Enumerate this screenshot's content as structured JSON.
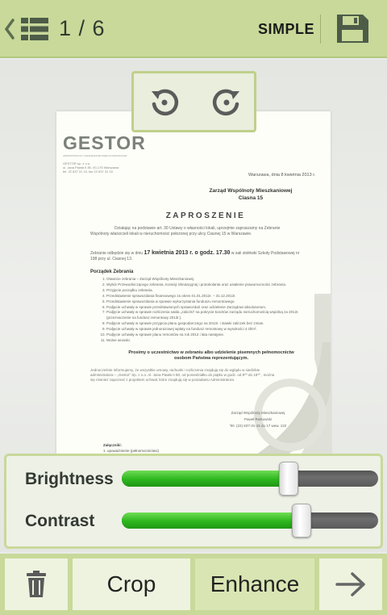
{
  "header": {
    "page_counter": "1 / 6",
    "mode": "SIMPLE",
    "icons": {
      "back": "chevron-left-icon",
      "list": "list-icon",
      "save": "floppy-disk-icon"
    }
  },
  "rotate": {
    "left_icon": "rotate-left-icon",
    "right_icon": "rotate-right-icon"
  },
  "document": {
    "logo": "GESTOR",
    "logo_sub": "ADMINISTRACJA I ZARZĄDZANIE NIERUCHOMOŚCIAMI",
    "sender": [
      "GESTOR sp. z o.o.",
      "ul. Jana Pawła II 80, 00-175 Warszawa",
      "tel. 22 637 31 15, fax 22 637 31 16"
    ],
    "date": "Warszawa, dnia 8 kwietnia 2013 r.",
    "recipient": [
      "Zarząd Wspólnoty Mieszkaniowej",
      "Ciasna 15"
    ],
    "title": "ZAPROSZENIE",
    "intro": "Działając na podstawie art. 30 Ustawy o własności lokali, uprzejmie zapraszamy na Zebranie Wspólnoty właścicieli lokali w nieruchomości położonej przy ulicy Ciasnej 15 w Warszawie.",
    "meeting_prefix": "Zebranie odbędzie się w dniu",
    "meeting_date": "17 kwietnia 2013 r. o godz. 17.30",
    "meeting_suffix": "w sali stołówki Szkoły Podstawowej nr 198 przy ul. Ciasnej 13.",
    "agenda_title": "Porządek Zebrania",
    "agenda": [
      "Otwarcie zebrania – Zarząd Wspólnoty Mieszkaniowej.",
      "Wybór Przewodniczącego zebrania, Komisji Skrutacyjnej i protokolanta oraz ustalenie prawomocności zebrania.",
      "Przyjęcie porządku zebrania.",
      "Przedstawienie sprawozdania finansowego za okres 01.01.2012r. – 31.12.2012r.",
      "Przedstawienie sprawozdania w sprawie wykorzystania funduszu remontowego.",
      "Podjęcie uchwały w sprawie przedstawionych sprawozdań oraz udzielenie Zarządowi absolutorium.",
      "Podjęcie uchwały w sprawie rozliczenia salda „zaliczki” na pokrycie kosztów zarządu nieruchomością wspólną za 2012r. (przeznaczenie na fundusz remontowy 2013r.).",
      "Podjęcie uchwały w sprawie przyjęcia planu gospodarczego na 2013r. i stawki zaliczek bez zmian.",
      "Podjęcie uchwały w sprawie jednorazowej wpłaty na fundusz remontowy w wysokości 4 zł/m².",
      "Podjęcie uchwały w sprawie planu remontów na rok 2013 i lata następne.",
      "Wolne wnioski."
    ],
    "request": [
      "Prosimy o uczestnictwo w zebraniu albo udzielenie pisemnych pełnomocnictw",
      "osobom Państwa reprezentującym."
    ],
    "info": "Jednocześnie informujemy, że wszystkie umowy, rachunki i rozliczenia znajdują się do wglądu w siedzibie administratora – „Gestor” Sp. z o.o. Al. Jana Pawła II 80, od poniedziałku do piątku w godz. od 8⁰⁰ do 16⁰⁰ , można się również zapoznać z projektem uchwał, które znajdują się w posiadaniu Administratora.",
    "signature": [
      "Zarząd Wspólnoty Mieszkaniowej",
      "Paweł Rutkowski",
      "Tel. (22) 637-31-15 do 17 wew. 122"
    ],
    "attachments_title": "Załączniki:",
    "attachments": [
      "1. upoważnienie (pełnomocnictwo)"
    ]
  },
  "adjustments": {
    "brightness": {
      "label": "Brightness",
      "value": 0.65
    },
    "contrast": {
      "label": "Contrast",
      "value": 0.7
    }
  },
  "bottom_bar": {
    "delete_icon": "trash-icon",
    "crop_label": "Crop",
    "enhance_label": "Enhance",
    "next_icon": "arrow-right-icon"
  },
  "colors": {
    "bar": "#c8d99a",
    "slider_fill": "#2db61e",
    "button_bg": "#eef3df",
    "active_button_bg": "#d9e6b3"
  }
}
